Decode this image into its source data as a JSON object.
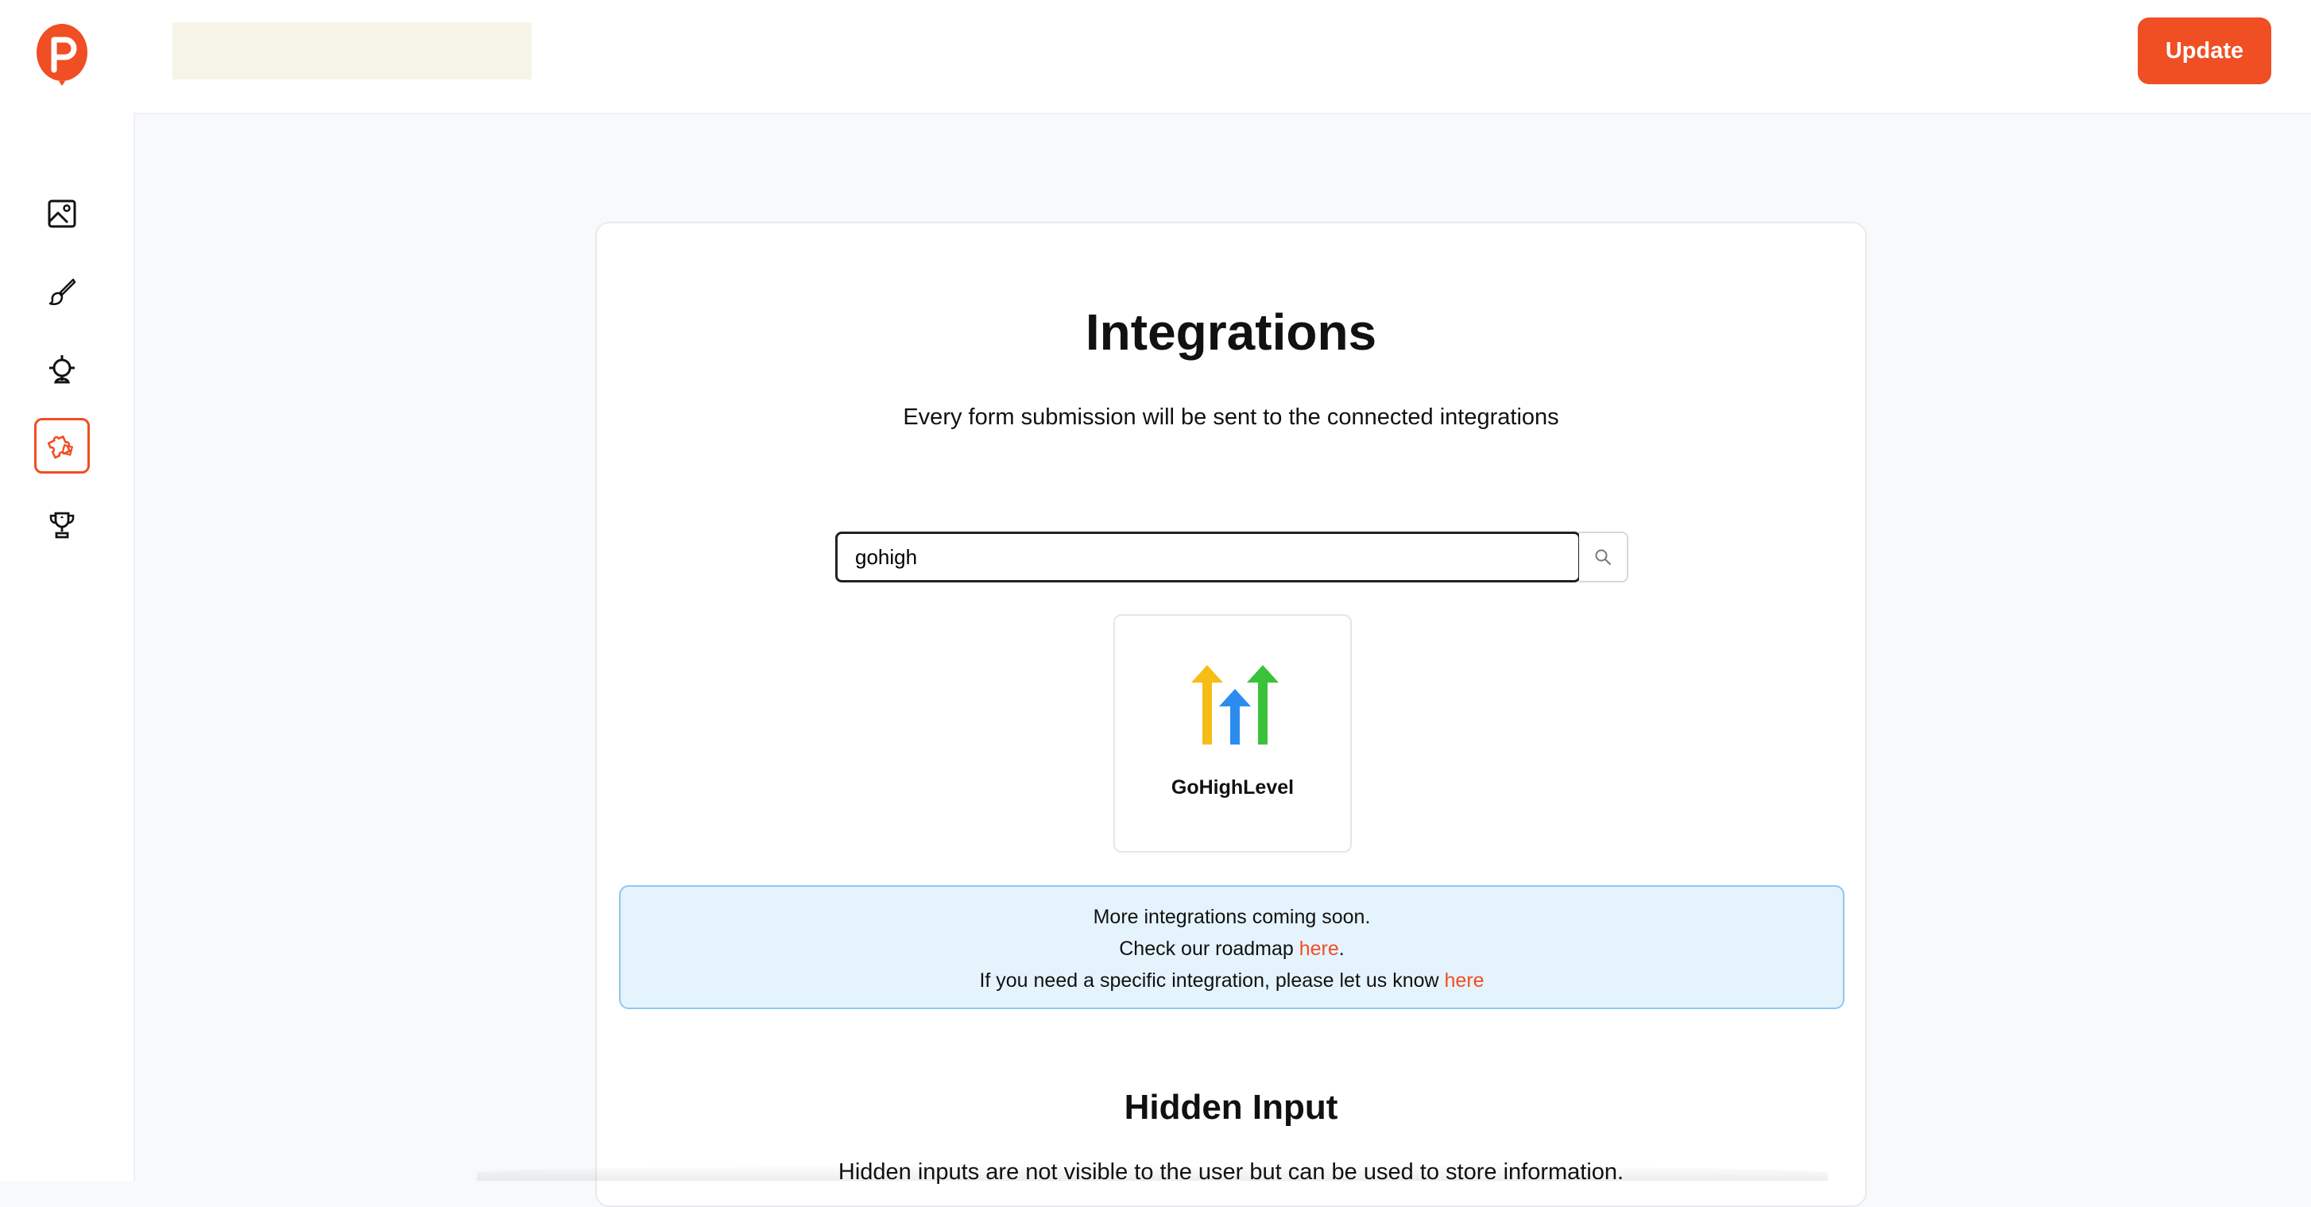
{
  "header": {
    "title_value": "",
    "update_label": "Update"
  },
  "sidebar": {
    "items": [
      {
        "icon": "image-icon",
        "label": "Media"
      },
      {
        "icon": "brush-icon",
        "label": "Design"
      },
      {
        "icon": "target-icon",
        "label": "Targeting"
      },
      {
        "icon": "puzzle-icon",
        "label": "Integrations",
        "active": true
      },
      {
        "icon": "trophy-icon",
        "label": "Rewards"
      }
    ]
  },
  "main": {
    "title": "Integrations",
    "subtitle": "Every form submission will be sent to the connected integrations",
    "search": {
      "value": "gohigh",
      "placeholder": ""
    },
    "results": [
      {
        "name": "GoHighLevel",
        "icon": "gohighlevel-logo"
      }
    ],
    "notice": {
      "line1": "More integrations coming soon.",
      "line2_prefix": "Check our roadmap ",
      "line2_link": "here",
      "line2_suffix": ".",
      "line3_prefix": "If you need a specific integration, please let us know ",
      "line3_link": "here"
    },
    "hidden_input": {
      "title": "Hidden Input",
      "description": "Hidden inputs are not visible to the user but can be used to store information."
    }
  },
  "colors": {
    "accent": "#f04e23",
    "notice_bg": "#e5f3fd",
    "notice_border": "#8cc8f0"
  }
}
